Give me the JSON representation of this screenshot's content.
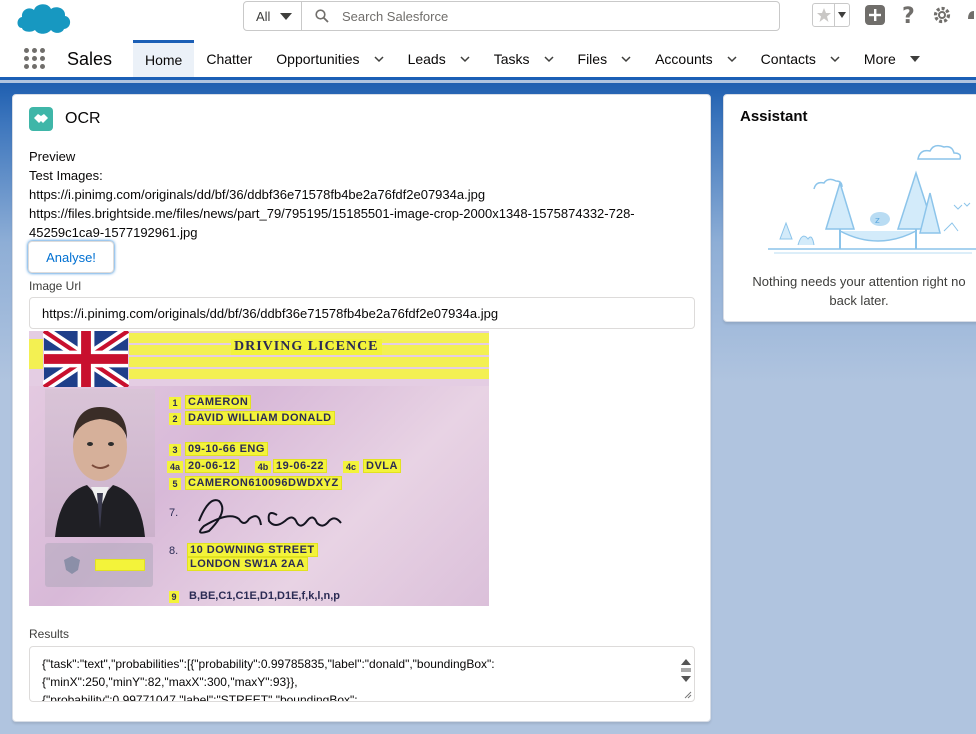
{
  "header": {
    "search_scope": "All",
    "search_placeholder": "Search Salesforce"
  },
  "nav": {
    "app_name": "Sales",
    "items": [
      {
        "label": "Home",
        "active": true,
        "has_menu": false
      },
      {
        "label": "Chatter",
        "active": false,
        "has_menu": false
      },
      {
        "label": "Opportunities",
        "active": false,
        "has_menu": true
      },
      {
        "label": "Leads",
        "active": false,
        "has_menu": true
      },
      {
        "label": "Tasks",
        "active": false,
        "has_menu": true
      },
      {
        "label": "Files",
        "active": false,
        "has_menu": true
      },
      {
        "label": "Accounts",
        "active": false,
        "has_menu": true
      },
      {
        "label": "Contacts",
        "active": false,
        "has_menu": true
      },
      {
        "label": "More",
        "active": false,
        "has_menu": true
      }
    ]
  },
  "ocr": {
    "title": "OCR",
    "preview_label": "Preview",
    "test_images_label": "Test Images:",
    "test_image_1": "https://i.pinimg.com/originals/dd/bf/36/ddbf36e71578fb4be2a76fdf2e07934a.jpg",
    "test_image_2a": "https://files.brightside.me/files/news/part_79/795195/15185501-image-crop-2000x1348-1575874332-728-",
    "test_image_2b": "45259c1ca9-1577192961.jpg",
    "analyse_label": "Analyse!",
    "image_url_label": "Image Url",
    "image_url_value": "https://i.pinimg.com/originals/dd/bf/36/ddbf36e71578fb4be2a76fdf2e07934a.jpg",
    "results_label": "Results",
    "results_line_1": "{\"task\":\"text\",\"probabilities\":[{\"probability\":0.99785835,\"label\":\"donald\",\"boundingBox\":",
    "results_line_2": "{\"minX\":250,\"minY\":82,\"maxX\":300,\"maxY\":93}},",
    "results_line_3": "{\"probability\":0.99771047,\"label\":\"STREET\",\"boundingBox\":"
  },
  "license": {
    "heading": "DRIVING LICENCE",
    "fields": [
      {
        "num": "1",
        "text": "CAMERON"
      },
      {
        "num": "2",
        "text": "DAVID WILLIAM DONALD"
      },
      {
        "num": "3",
        "text": "09-10-66  ENG"
      },
      {
        "num": "4a",
        "text": "20-06-12"
      },
      {
        "num": "4b",
        "text": "19-06-22"
      },
      {
        "num": "4c",
        "text": "DVLA"
      },
      {
        "num": "5",
        "text": "CAMERON610096DWDXYZ"
      },
      {
        "num": "8",
        "text": "10 DOWNING STREET"
      },
      {
        "num": "",
        "text": "LONDON  SW1A 2AA"
      },
      {
        "num": "9",
        "text": "B,BE,C1,C1E,D1,D1E,f,k,l,n,p"
      }
    ],
    "field_7": "7.",
    "field_8": "8."
  },
  "assistant": {
    "title": "Assistant",
    "message_1": "Nothing needs your attention right no",
    "message_2": "back later."
  },
  "colors": {
    "brand_blue": "#1b5fb6",
    "link_blue": "#0070d2",
    "ocr_highlight": "#f3f33a",
    "card_icon": "#3fb6a8"
  }
}
